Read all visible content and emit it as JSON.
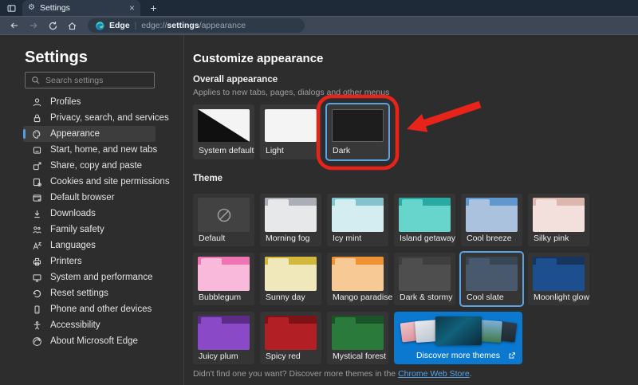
{
  "window": {
    "tab_title": "Settings",
    "new_tab_glyph": "+",
    "close_glyph": "×",
    "url": {
      "brand": "Edge",
      "scheme": "edge://",
      "host": "settings",
      "path": "/appearance"
    }
  },
  "sidebar": {
    "title": "Settings",
    "search_placeholder": "Search settings",
    "items": [
      {
        "label": "Profiles",
        "icon": "person-icon",
        "selected": false
      },
      {
        "label": "Privacy, search, and services",
        "icon": "lock-icon",
        "selected": false
      },
      {
        "label": "Appearance",
        "icon": "palette-icon",
        "selected": true
      },
      {
        "label": "Start, home, and new tabs",
        "icon": "window-icon",
        "selected": false
      },
      {
        "label": "Share, copy and paste",
        "icon": "share-icon",
        "selected": false
      },
      {
        "label": "Cookies and site permissions",
        "icon": "cookies-icon",
        "selected": false
      },
      {
        "label": "Default browser",
        "icon": "browser-check-icon",
        "selected": false
      },
      {
        "label": "Downloads",
        "icon": "download-icon",
        "selected": false
      },
      {
        "label": "Family safety",
        "icon": "family-icon",
        "selected": false
      },
      {
        "label": "Languages",
        "icon": "language-icon",
        "selected": false
      },
      {
        "label": "Printers",
        "icon": "printer-icon",
        "selected": false
      },
      {
        "label": "System and performance",
        "icon": "monitor-icon",
        "selected": false
      },
      {
        "label": "Reset settings",
        "icon": "reset-icon",
        "selected": false
      },
      {
        "label": "Phone and other devices",
        "icon": "phone-icon",
        "selected": false
      },
      {
        "label": "Accessibility",
        "icon": "accessibility-icon",
        "selected": false
      },
      {
        "label": "About Microsoft Edge",
        "icon": "edge-logo-icon",
        "selected": false
      }
    ]
  },
  "main": {
    "title": "Customize appearance",
    "overall_appearance": {
      "heading": "Overall appearance",
      "description": "Applies to new tabs, pages, dialogs and other menus",
      "options": [
        {
          "label": "System default",
          "selected": false
        },
        {
          "label": "Light",
          "selected": false
        },
        {
          "label": "Dark",
          "selected": true
        }
      ]
    },
    "theme": {
      "heading": "Theme",
      "tiles": [
        {
          "name": "Default",
          "selected": false,
          "style": "--body:#424242;--strip:#424242"
        },
        {
          "name": "Morning fog",
          "selected": false,
          "style": "--body:#e6e8ea;--strip:#a9aeb7"
        },
        {
          "name": "Icy mint",
          "selected": false,
          "style": "--body:#d3edf0;--strip:#82c4cc"
        },
        {
          "name": "Island getaway",
          "selected": false,
          "style": "--body:#68d5cc;--strip:#2aa9a3"
        },
        {
          "name": "Cool breeze",
          "selected": false,
          "style": "--body:#aac2de;--strip:#6197cf"
        },
        {
          "name": "Silky pink",
          "selected": false,
          "style": "--body:#f3dfdb;--strip:#ddb6ae"
        },
        {
          "name": "Bubblegum",
          "selected": false,
          "style": "--body:#f8b9da;--strip:#ef74b2"
        },
        {
          "name": "Sunny day",
          "selected": false,
          "style": "--body:#f0e7ba;--strip:#d2b83c"
        },
        {
          "name": "Mango paradise",
          "selected": false,
          "style": "--body:#f7c994;--strip:#f09234"
        },
        {
          "name": "Dark & stormy",
          "selected": false,
          "style": "--body:#4e4e4e;--strip:#3f3f3f"
        },
        {
          "name": "Cool slate",
          "selected": true,
          "style": "--body:#49596d;--strip:#394655"
        },
        {
          "name": "Moonlight glow",
          "selected": false,
          "style": "--body:#1d4e8e;--strip:#16365e"
        },
        {
          "name": "Juicy plum",
          "selected": false,
          "style": "--body:#8a4ac7;--strip:#5a2c86"
        },
        {
          "name": "Spicy red",
          "selected": false,
          "style": "--body:#b22025;--strip:#7d1316"
        },
        {
          "name": "Mystical forest",
          "selected": false,
          "style": "--body:#2a7a3b;--strip:#1b5328"
        }
      ],
      "discover_label": "Discover more themes"
    },
    "footer": {
      "text_before": "Didn't find one you want? Discover more themes in the ",
      "link_label": "Chrome Web Store",
      "text_after": "."
    }
  },
  "colors": {
    "accent_blue": "#0b79d0",
    "selection_outline": "#5ba2e0",
    "annotation_red": "#e8231a",
    "link_blue": "#54a4e8"
  }
}
